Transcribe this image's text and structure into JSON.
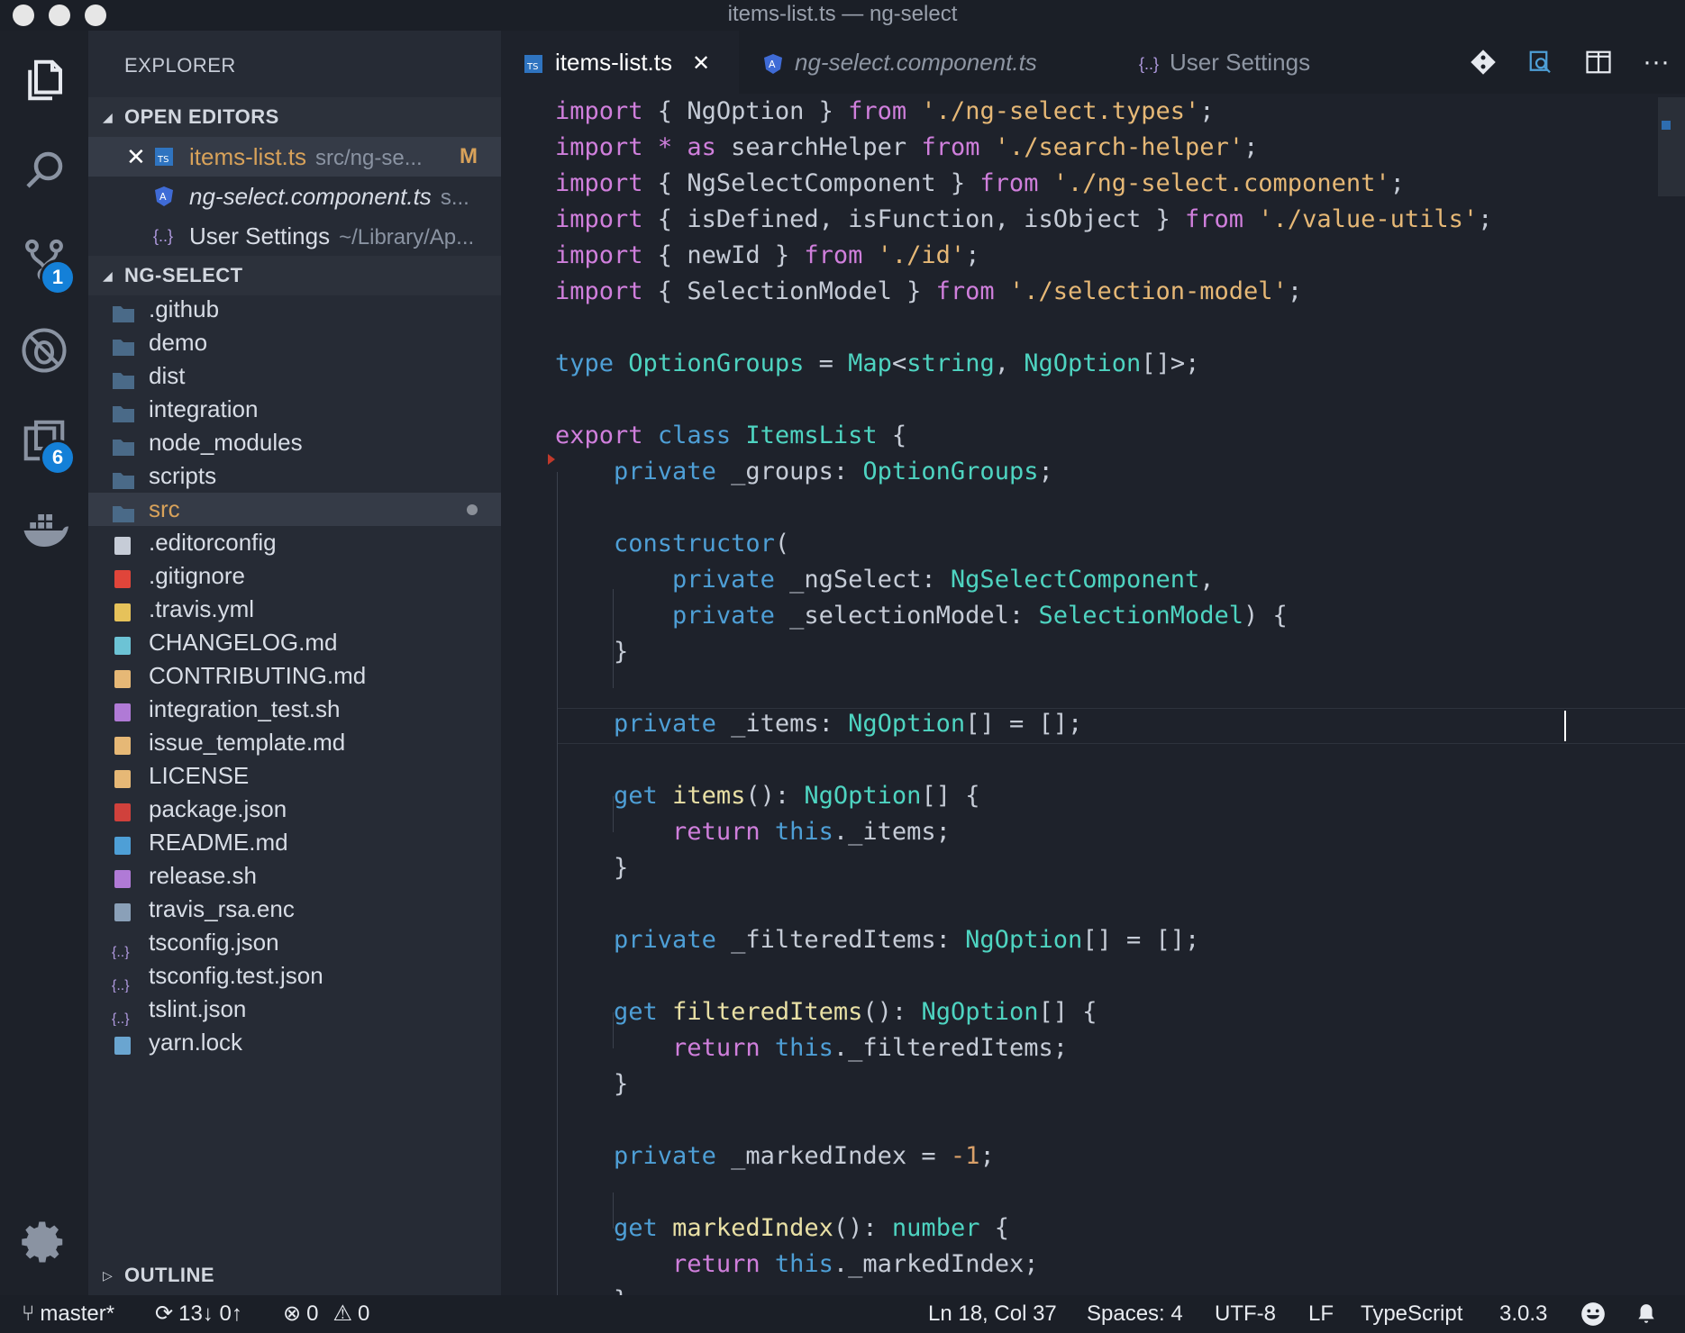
{
  "window": {
    "title": "items-list.ts — ng-select"
  },
  "activity_bar": {
    "items": [
      {
        "name": "explorer",
        "icon": "files-icon"
      },
      {
        "name": "search",
        "icon": "search-icon"
      },
      {
        "name": "source-control",
        "icon": "source-control-icon",
        "badge": "1"
      },
      {
        "name": "debug",
        "icon": "debug-icon"
      },
      {
        "name": "extensions",
        "icon": "extensions-icon",
        "badge": "6"
      },
      {
        "name": "docker",
        "icon": "docker-icon"
      }
    ],
    "bottom": {
      "name": "manage",
      "icon": "gear-icon"
    }
  },
  "sidebar": {
    "title": "EXPLORER",
    "open_editors": {
      "label": "OPEN EDITORS",
      "items": [
        {
          "name": "items-list.ts",
          "desc": "src/ng-se...",
          "flag": "M",
          "icon": "typescript-icon"
        },
        {
          "name": "ng-select.component.ts",
          "desc": "s...",
          "icon": "angular-icon"
        },
        {
          "name": "User Settings",
          "desc": "~/Library/Ap...",
          "icon": "json-icon"
        }
      ]
    },
    "project": {
      "label": "NG-SELECT",
      "items": [
        {
          "name": ".github",
          "icon": "folder-github-icon"
        },
        {
          "name": "demo",
          "icon": "folder-icon"
        },
        {
          "name": "dist",
          "icon": "folder-dist-icon"
        },
        {
          "name": "integration",
          "icon": "folder-icon"
        },
        {
          "name": "node_modules",
          "icon": "folder-node-icon"
        },
        {
          "name": "scripts",
          "icon": "folder-icon"
        },
        {
          "name": "src",
          "icon": "folder-src-icon"
        },
        {
          "name": ".editorconfig",
          "icon": "tools-icon"
        },
        {
          "name": ".gitignore",
          "icon": "git-icon"
        },
        {
          "name": ".travis.yml",
          "icon": "yaml-icon"
        },
        {
          "name": "CHANGELOG.md",
          "icon": "changelog-icon"
        },
        {
          "name": "CONTRIBUTING.md",
          "icon": "clipboard-icon"
        },
        {
          "name": "integration_test.sh",
          "icon": "terminal-icon"
        },
        {
          "name": "issue_template.md",
          "icon": "markdown-icon"
        },
        {
          "name": "LICENSE",
          "icon": "copyright-icon"
        },
        {
          "name": "package.json",
          "icon": "npm-icon"
        },
        {
          "name": "README.md",
          "icon": "info-icon"
        },
        {
          "name": "release.sh",
          "icon": "terminal-icon"
        },
        {
          "name": "travis_rsa.enc",
          "icon": "file-icon"
        },
        {
          "name": "tsconfig.json",
          "icon": "json-icon"
        },
        {
          "name": "tsconfig.test.json",
          "icon": "json-icon"
        },
        {
          "name": "tslint.json",
          "icon": "json-icon"
        },
        {
          "name": "yarn.lock",
          "icon": "yarn-lock-icon"
        }
      ]
    },
    "outline": {
      "label": "OUTLINE"
    }
  },
  "tabs": [
    {
      "label": "items-list.ts",
      "active": true,
      "icon": "typescript-icon",
      "close": "✕"
    },
    {
      "label": "ng-select.component.ts",
      "active": false,
      "icon": "angular-icon"
    },
    {
      "label": "User Settings",
      "active": false,
      "icon": "json-icon"
    }
  ],
  "tab_actions": [
    "git-compare-icon",
    "open-preview-icon",
    "split-editor-icon",
    "more-icon"
  ],
  "editor": {
    "language": "TypeScript",
    "lines": [
      [
        [
          "kw",
          "import"
        ],
        [
          "pl",
          " { NgOption } "
        ],
        [
          "kw",
          "from"
        ],
        [
          "pl",
          " "
        ],
        [
          "st",
          "'./ng-select.types'"
        ],
        [
          "pl",
          ";"
        ]
      ],
      [
        [
          "kw",
          "import"
        ],
        [
          "pl",
          " "
        ],
        [
          "kw",
          "*"
        ],
        [
          "pl",
          " "
        ],
        [
          "kw",
          "as"
        ],
        [
          "pl",
          " searchHelper "
        ],
        [
          "kw",
          "from"
        ],
        [
          "pl",
          " "
        ],
        [
          "st",
          "'./search-helper'"
        ],
        [
          "pl",
          ";"
        ]
      ],
      [
        [
          "kw",
          "import"
        ],
        [
          "pl",
          " { NgSelectComponent } "
        ],
        [
          "kw",
          "from"
        ],
        [
          "pl",
          " "
        ],
        [
          "st",
          "'./ng-select.component'"
        ],
        [
          "pl",
          ";"
        ]
      ],
      [
        [
          "kw",
          "import"
        ],
        [
          "pl",
          " { isDefined, isFunction, isObject } "
        ],
        [
          "kw",
          "from"
        ],
        [
          "pl",
          " "
        ],
        [
          "st",
          "'./value-utils'"
        ],
        [
          "pl",
          ";"
        ]
      ],
      [
        [
          "kw",
          "import"
        ],
        [
          "pl",
          " { newId } "
        ],
        [
          "kw",
          "from"
        ],
        [
          "pl",
          " "
        ],
        [
          "st",
          "'./id'"
        ],
        [
          "pl",
          ";"
        ]
      ],
      [
        [
          "kw",
          "import"
        ],
        [
          "pl",
          " { SelectionModel } "
        ],
        [
          "kw",
          "from"
        ],
        [
          "pl",
          " "
        ],
        [
          "st",
          "'./selection-model'"
        ],
        [
          "pl",
          ";"
        ]
      ],
      [],
      [
        [
          "sk",
          "type"
        ],
        [
          "pl",
          " "
        ],
        [
          "ty",
          "OptionGroups"
        ],
        [
          "pl",
          " = "
        ],
        [
          "ty",
          "Map"
        ],
        [
          "pl",
          "<"
        ],
        [
          "ty",
          "string"
        ],
        [
          "pl",
          ", "
        ],
        [
          "ty",
          "NgOption"
        ],
        [
          "pl",
          "[]>;"
        ]
      ],
      [],
      [
        [
          "kw",
          "export"
        ],
        [
          "pl",
          " "
        ],
        [
          "sk",
          "class"
        ],
        [
          "pl",
          " "
        ],
        [
          "ty",
          "ItemsList"
        ],
        [
          "pl",
          " {"
        ]
      ],
      [
        [
          "pl",
          "    "
        ],
        [
          "sk",
          "private"
        ],
        [
          "pl",
          " _groups: "
        ],
        [
          "ty",
          "OptionGroups"
        ],
        [
          "pl",
          ";"
        ]
      ],
      [],
      [
        [
          "pl",
          "    "
        ],
        [
          "sk",
          "constructor"
        ],
        [
          "pl",
          "("
        ]
      ],
      [
        [
          "pl",
          "        "
        ],
        [
          "sk",
          "private"
        ],
        [
          "pl",
          " _ngSelect: "
        ],
        [
          "ty",
          "NgSelectComponent"
        ],
        [
          "pl",
          ","
        ]
      ],
      [
        [
          "pl",
          "        "
        ],
        [
          "sk",
          "private"
        ],
        [
          "pl",
          " _selectionModel: "
        ],
        [
          "ty",
          "SelectionModel"
        ],
        [
          "pl",
          ") {"
        ]
      ],
      [
        [
          "pl",
          "    }"
        ]
      ],
      [],
      [
        [
          "pl",
          "    "
        ],
        [
          "sk",
          "private"
        ],
        [
          "pl",
          " _items: "
        ],
        [
          "ty",
          "NgOption"
        ],
        [
          "pl",
          "[] = [];"
        ]
      ],
      [],
      [
        [
          "pl",
          "    "
        ],
        [
          "sk",
          "get"
        ],
        [
          "pl",
          " "
        ],
        [
          "fn",
          "items"
        ],
        [
          "pl",
          "(): "
        ],
        [
          "ty",
          "NgOption"
        ],
        [
          "pl",
          "[] {"
        ]
      ],
      [
        [
          "pl",
          "        "
        ],
        [
          "kw",
          "return"
        ],
        [
          "pl",
          " "
        ],
        [
          "sk",
          "this"
        ],
        [
          "pl",
          "._items;"
        ]
      ],
      [
        [
          "pl",
          "    }"
        ]
      ],
      [],
      [
        [
          "pl",
          "    "
        ],
        [
          "sk",
          "private"
        ],
        [
          "pl",
          " _filteredItems: "
        ],
        [
          "ty",
          "NgOption"
        ],
        [
          "pl",
          "[] = [];"
        ]
      ],
      [],
      [
        [
          "pl",
          "    "
        ],
        [
          "sk",
          "get"
        ],
        [
          "pl",
          " "
        ],
        [
          "fn",
          "filteredItems"
        ],
        [
          "pl",
          "(): "
        ],
        [
          "ty",
          "NgOption"
        ],
        [
          "pl",
          "[] {"
        ]
      ],
      [
        [
          "pl",
          "        "
        ],
        [
          "kw",
          "return"
        ],
        [
          "pl",
          " "
        ],
        [
          "sk",
          "this"
        ],
        [
          "pl",
          "._filteredItems;"
        ]
      ],
      [
        [
          "pl",
          "    }"
        ]
      ],
      [],
      [
        [
          "pl",
          "    "
        ],
        [
          "sk",
          "private"
        ],
        [
          "pl",
          " _markedIndex = "
        ],
        [
          "nu",
          "-1"
        ],
        [
          "pl",
          ";"
        ]
      ],
      [],
      [
        [
          "pl",
          "    "
        ],
        [
          "sk",
          "get"
        ],
        [
          "pl",
          " "
        ],
        [
          "fn",
          "markedIndex"
        ],
        [
          "pl",
          "(): "
        ],
        [
          "ty",
          "number"
        ],
        [
          "pl",
          " {"
        ]
      ],
      [
        [
          "pl",
          "        "
        ],
        [
          "kw",
          "return"
        ],
        [
          "pl",
          " "
        ],
        [
          "sk",
          "this"
        ],
        [
          "pl",
          "._markedIndex;"
        ]
      ],
      [
        [
          "pl",
          "    }"
        ]
      ]
    ]
  },
  "statusbar": {
    "branch": "master*",
    "sync": "13↓ 0↑",
    "errors": "0",
    "warnings": "0",
    "position": "Ln 18, Col 37",
    "spaces": "Spaces: 4",
    "encoding": "UTF-8",
    "eol": "LF",
    "language": "TypeScript",
    "version": "3.0.3"
  }
}
